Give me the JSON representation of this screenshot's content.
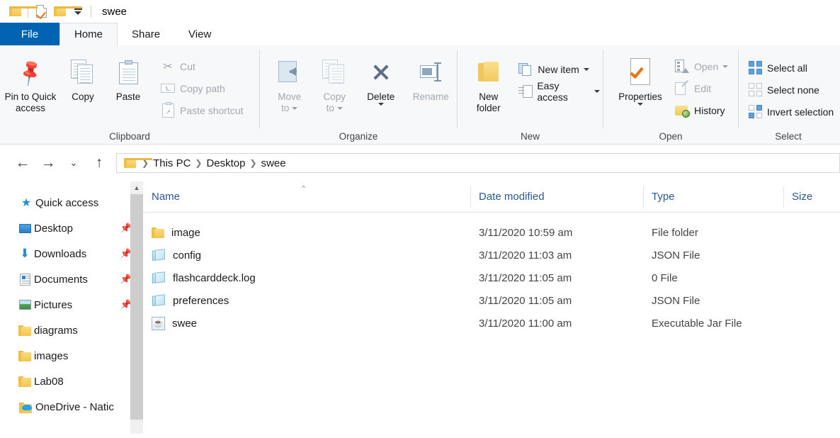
{
  "window": {
    "title": "swee",
    "quick_access_toolbar": [
      {
        "name": "folder-icon",
        "label": "Folder"
      },
      {
        "name": "properties-icon",
        "label": "Properties"
      },
      {
        "name": "new-folder-icon",
        "label": "New folder"
      },
      {
        "name": "customize-dropdown-icon",
        "label": "Customize Quick Access Toolbar"
      }
    ]
  },
  "ribbon": {
    "tabs": [
      {
        "label": "File",
        "active": false,
        "style": "file"
      },
      {
        "label": "Home",
        "active": true
      },
      {
        "label": "Share",
        "active": false
      },
      {
        "label": "View",
        "active": false
      }
    ],
    "groups": [
      {
        "label": "Clipboard",
        "big_buttons": [
          {
            "label_line1": "Pin to Quick",
            "label_line2": "access",
            "icon": "pin-icon",
            "disabled": false
          },
          {
            "label_line1": "Copy",
            "label_line2": "",
            "icon": "copy-icon",
            "disabled": false
          },
          {
            "label_line1": "Paste",
            "label_line2": "",
            "icon": "paste-icon",
            "disabled": false
          }
        ],
        "small_buttons": [
          {
            "label": "Cut",
            "icon": "scissors-icon",
            "disabled": true
          },
          {
            "label": "Copy path",
            "icon": "copy-path-icon",
            "disabled": true
          },
          {
            "label": "Paste shortcut",
            "icon": "paste-shortcut-icon",
            "disabled": true
          }
        ]
      },
      {
        "label": "Organize",
        "big_buttons": [
          {
            "label_line1": "Move",
            "label_line2": "to",
            "icon": "move-to-icon",
            "disabled": true,
            "dropdown": true
          },
          {
            "label_line1": "Copy",
            "label_line2": "to",
            "icon": "copy-to-icon",
            "disabled": true,
            "dropdown": true
          },
          {
            "label_line1": "Delete",
            "label_line2": "",
            "icon": "delete-icon",
            "disabled": false,
            "dropdown": true
          },
          {
            "label_line1": "Rename",
            "label_line2": "",
            "icon": "rename-icon",
            "disabled": true
          }
        ]
      },
      {
        "label": "New",
        "big_buttons": [
          {
            "label_line1": "New",
            "label_line2": "folder",
            "icon": "new-folder-icon",
            "disabled": false
          }
        ],
        "small_buttons": [
          {
            "label": "New item",
            "icon": "new-item-icon",
            "disabled": false,
            "dropdown": true
          },
          {
            "label": "Easy access",
            "icon": "easy-access-icon",
            "disabled": false,
            "dropdown": true
          }
        ]
      },
      {
        "label": "Open",
        "big_buttons": [
          {
            "label_line1": "Properties",
            "label_line2": "",
            "icon": "properties-icon",
            "disabled": false,
            "dropdown": true
          }
        ],
        "small_buttons": [
          {
            "label": "Open",
            "icon": "open-icon",
            "disabled": true,
            "dropdown": true
          },
          {
            "label": "Edit",
            "icon": "edit-icon",
            "disabled": true
          },
          {
            "label": "History",
            "icon": "history-icon",
            "disabled": false
          }
        ]
      },
      {
        "label": "Select",
        "small_buttons": [
          {
            "label": "Select all",
            "icon": "select-all-icon",
            "disabled": false
          },
          {
            "label": "Select none",
            "icon": "select-none-icon",
            "disabled": false
          },
          {
            "label": "Invert selection",
            "icon": "invert-selection-icon",
            "disabled": false
          }
        ]
      }
    ]
  },
  "address_bar": {
    "back_label": "Back",
    "forward_label": "Forward",
    "recent_label": "Recent locations",
    "up_label": "Up",
    "breadcrumbs": [
      "This PC",
      "Desktop",
      "swee"
    ]
  },
  "sidebar": {
    "items": [
      {
        "label": "Quick access",
        "icon": "star-icon",
        "level": 0,
        "pinned": false
      },
      {
        "label": "Desktop",
        "icon": "desktop-icon",
        "level": 1,
        "pinned": true
      },
      {
        "label": "Downloads",
        "icon": "downloads-icon",
        "level": 1,
        "pinned": true
      },
      {
        "label": "Documents",
        "icon": "documents-icon",
        "level": 1,
        "pinned": true
      },
      {
        "label": "Pictures",
        "icon": "pictures-icon",
        "level": 1,
        "pinned": true
      },
      {
        "label": "diagrams",
        "icon": "folder-icon",
        "level": 1,
        "pinned": false
      },
      {
        "label": "images",
        "icon": "folder-icon",
        "level": 1,
        "pinned": false
      },
      {
        "label": "Lab08",
        "icon": "folder-icon",
        "level": 1,
        "pinned": false
      },
      {
        "label": "OneDrive - Natic",
        "icon": "onedrive-icon",
        "level": 0,
        "pinned": false
      }
    ]
  },
  "file_list": {
    "columns": [
      {
        "label": "Name",
        "sorted": "asc"
      },
      {
        "label": "Date modified",
        "sorted": ""
      },
      {
        "label": "Type",
        "sorted": ""
      },
      {
        "label": "Size",
        "sorted": ""
      }
    ],
    "rows": [
      {
        "name": "image",
        "date": "3/11/2020 10:59 am",
        "type": "File folder",
        "size": "",
        "icon": "folder-icon"
      },
      {
        "name": "config",
        "date": "3/11/2020 11:03 am",
        "type": "JSON File",
        "size": "",
        "icon": "json-file-icon"
      },
      {
        "name": "flashcarddeck.log",
        "date": "3/11/2020 11:05 am",
        "type": "0 File",
        "size": "",
        "icon": "json-file-icon"
      },
      {
        "name": "preferences",
        "date": "3/11/2020 11:05 am",
        "type": "JSON File",
        "size": "",
        "icon": "json-file-icon"
      },
      {
        "name": "swee",
        "date": "3/11/2020 11:00 am",
        "type": "Executable Jar File",
        "size": "",
        "icon": "jar-file-icon"
      }
    ]
  },
  "colors": {
    "file_tab_blue": "#0063b1",
    "ribbon_bg": "#f6f8fa",
    "header_text": "#2b5797",
    "folder_yellow": "#f3c54e",
    "accent_orange": "#e8730c"
  }
}
